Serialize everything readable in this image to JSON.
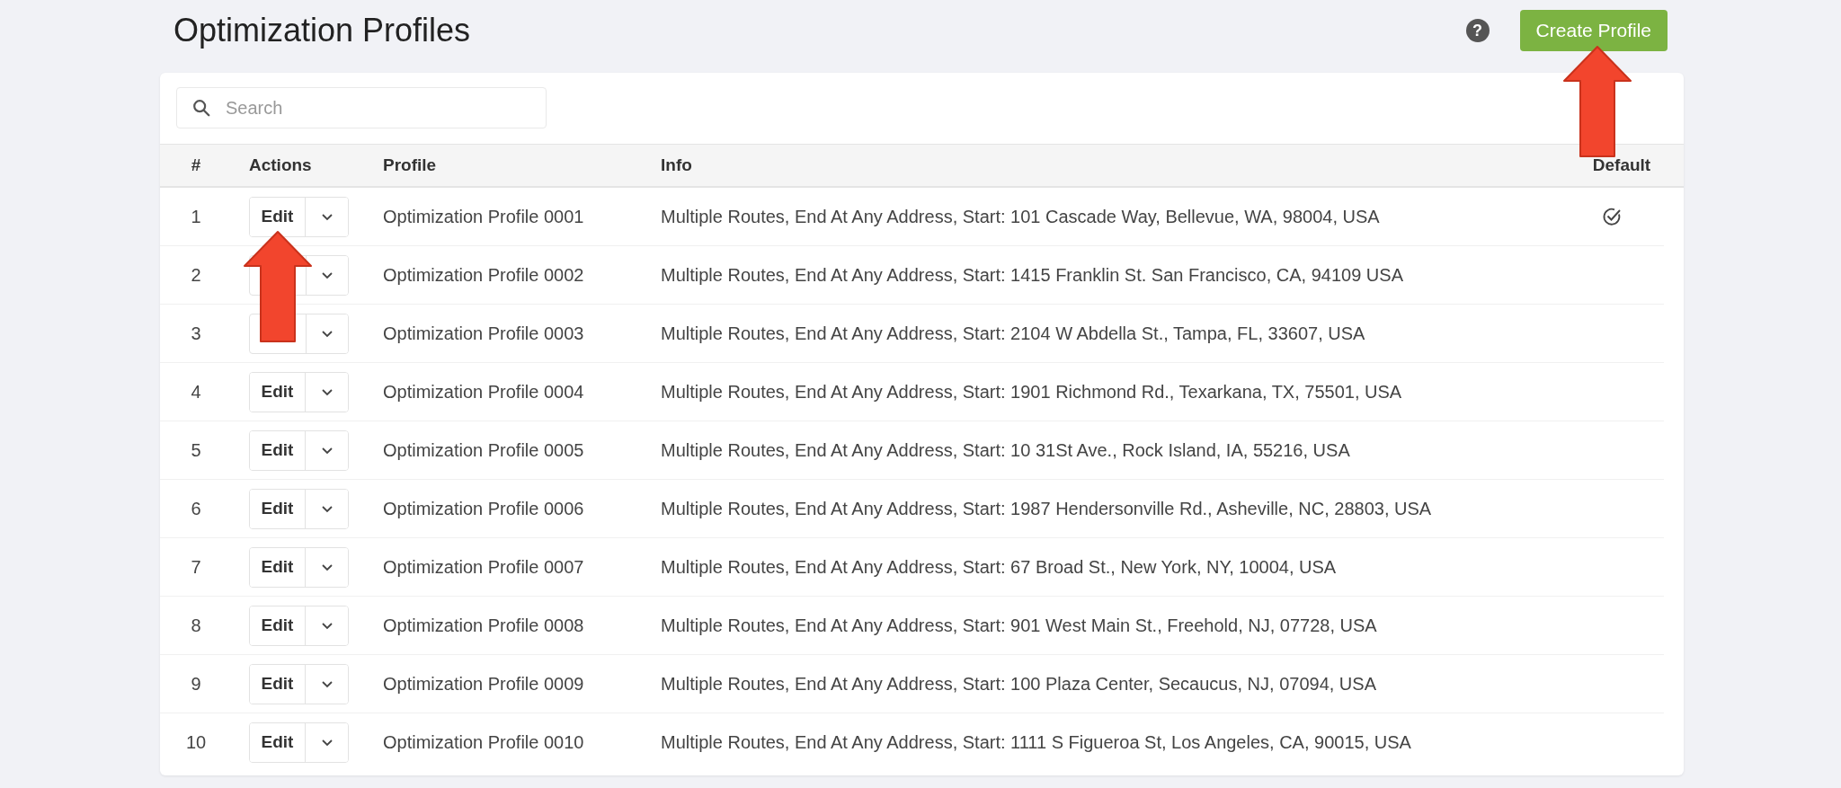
{
  "page": {
    "title": "Optimization Profiles",
    "help": "?",
    "create_button": "Create Profile"
  },
  "search": {
    "placeholder": "Search"
  },
  "table": {
    "columns": [
      "#",
      "Actions",
      "Profile",
      "Info",
      "Default"
    ],
    "rows": [
      {
        "num": "1",
        "edit": "Edit",
        "profile": "Optimization Profile 0001",
        "info": "Multiple Routes, End At Any Address, Start: 101 Cascade Way, Bellevue, WA, 98004, USA",
        "default": true
      },
      {
        "num": "2",
        "profile": "Optimization Profile 0002",
        "info": "Multiple Routes, End At Any Address, Start: 1415 Franklin St. San Francisco, CA, 94109 USA",
        "default": false
      },
      {
        "num": "3",
        "profile": "Optimization Profile 0003",
        "info": "Multiple Routes, End At Any Address, Start: 2104 W Abdella St., Tampa, FL, 33607, USA",
        "default": false
      },
      {
        "num": "4",
        "edit": "Edit",
        "profile": "Optimization Profile 0004",
        "info": "Multiple Routes, End At Any Address, Start: 1901 Richmond Rd., Texarkana, TX, 75501, USA",
        "default": false
      },
      {
        "num": "5",
        "edit": "Edit",
        "profile": "Optimization Profile 0005",
        "info": "Multiple Routes, End At Any Address, Start: 10 31St Ave., Rock Island, IA, 55216, USA",
        "default": false
      },
      {
        "num": "6",
        "edit": "Edit",
        "profile": "Optimization Profile 0006",
        "info": "Multiple Routes, End At Any Address, Start: 1987 Hendersonville Rd., Asheville, NC, 28803, USA",
        "default": false
      },
      {
        "num": "7",
        "edit": "Edit",
        "profile": "Optimization Profile 0007",
        "info": "Multiple Routes, End At Any Address, Start: 67 Broad St., New York, NY, 10004, USA",
        "default": false
      },
      {
        "num": "8",
        "edit": "Edit",
        "profile": "Optimization Profile 0008",
        "info": "Multiple Routes, End At Any Address, Start: 901 West Main St., Freehold, NJ, 07728, USA",
        "default": false
      },
      {
        "num": "9",
        "edit": "Edit",
        "profile": "Optimization Profile 0009",
        "info": "Multiple Routes, End At Any Address, Start: 100 Plaza Center, Secaucus, NJ, 07094, USA",
        "default": false
      },
      {
        "num": "10",
        "edit": "Edit",
        "profile": "Optimization Profile 0010",
        "info": "Multiple Routes, End At Any Address, Start: 1111 S Figueroa St, Los Angeles, CA, 90015, USA",
        "default": false
      }
    ]
  }
}
